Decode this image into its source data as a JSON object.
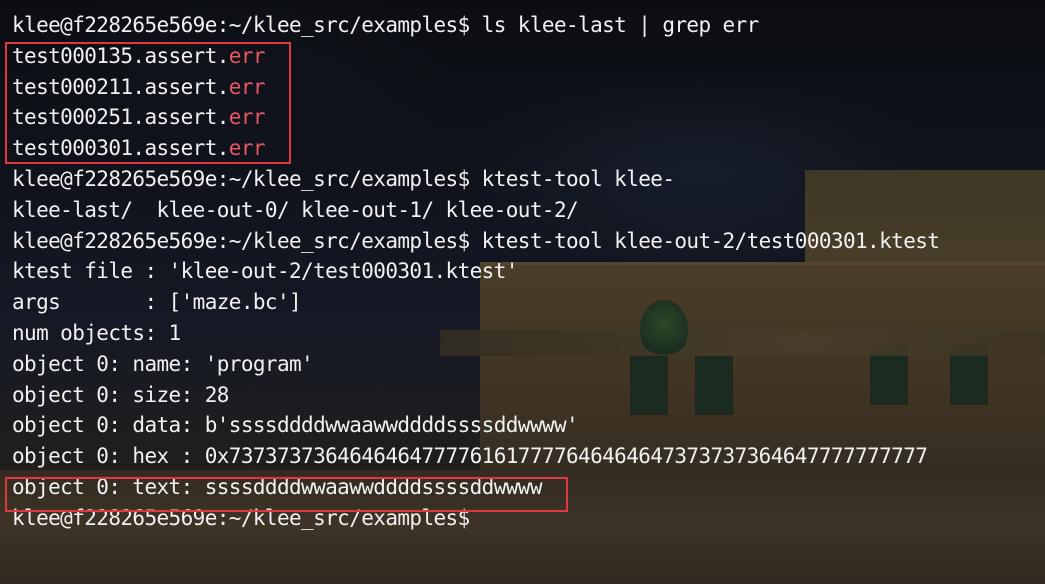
{
  "theme": {
    "text_color": "#f1f1f1",
    "err_color": "#e45862",
    "highlight_color": "#e0383e"
  },
  "terminal": {
    "lines": [
      "klee@f228265e569e:~/klee_src/examples$ ls klee-last | grep err",
      "",
      "",
      "",
      "",
      "klee@f228265e569e:~/klee_src/examples$ ktest-tool klee-",
      "klee-last/  klee-out-0/ klee-out-1/ klee-out-2/",
      "klee@f228265e569e:~/klee_src/examples$ ktest-tool klee-out-2/test000301.ktest",
      "ktest file : 'klee-out-2/test000301.ktest'",
      "args       : ['maze.bc']",
      "num objects: 1",
      "object 0: name: 'program'",
      "object 0: size: 28",
      "object 0: data: b'ssssddddwwaawwddddssssddwwww'",
      "object 0: hex : 0x7373737364646464777761617777646464647373737364647777777777",
      "object 0: text: ssssddddwwaawwddddssssddwwww",
      "klee@f228265e569e:~/klee_src/examples$"
    ],
    "err_files": [
      {
        "base": "test000135.assert.",
        "ext": "err"
      },
      {
        "base": "test000211.assert.",
        "ext": "err"
      },
      {
        "base": "test000251.assert.",
        "ext": "err"
      },
      {
        "base": "test000301.assert.",
        "ext": "err"
      }
    ]
  }
}
